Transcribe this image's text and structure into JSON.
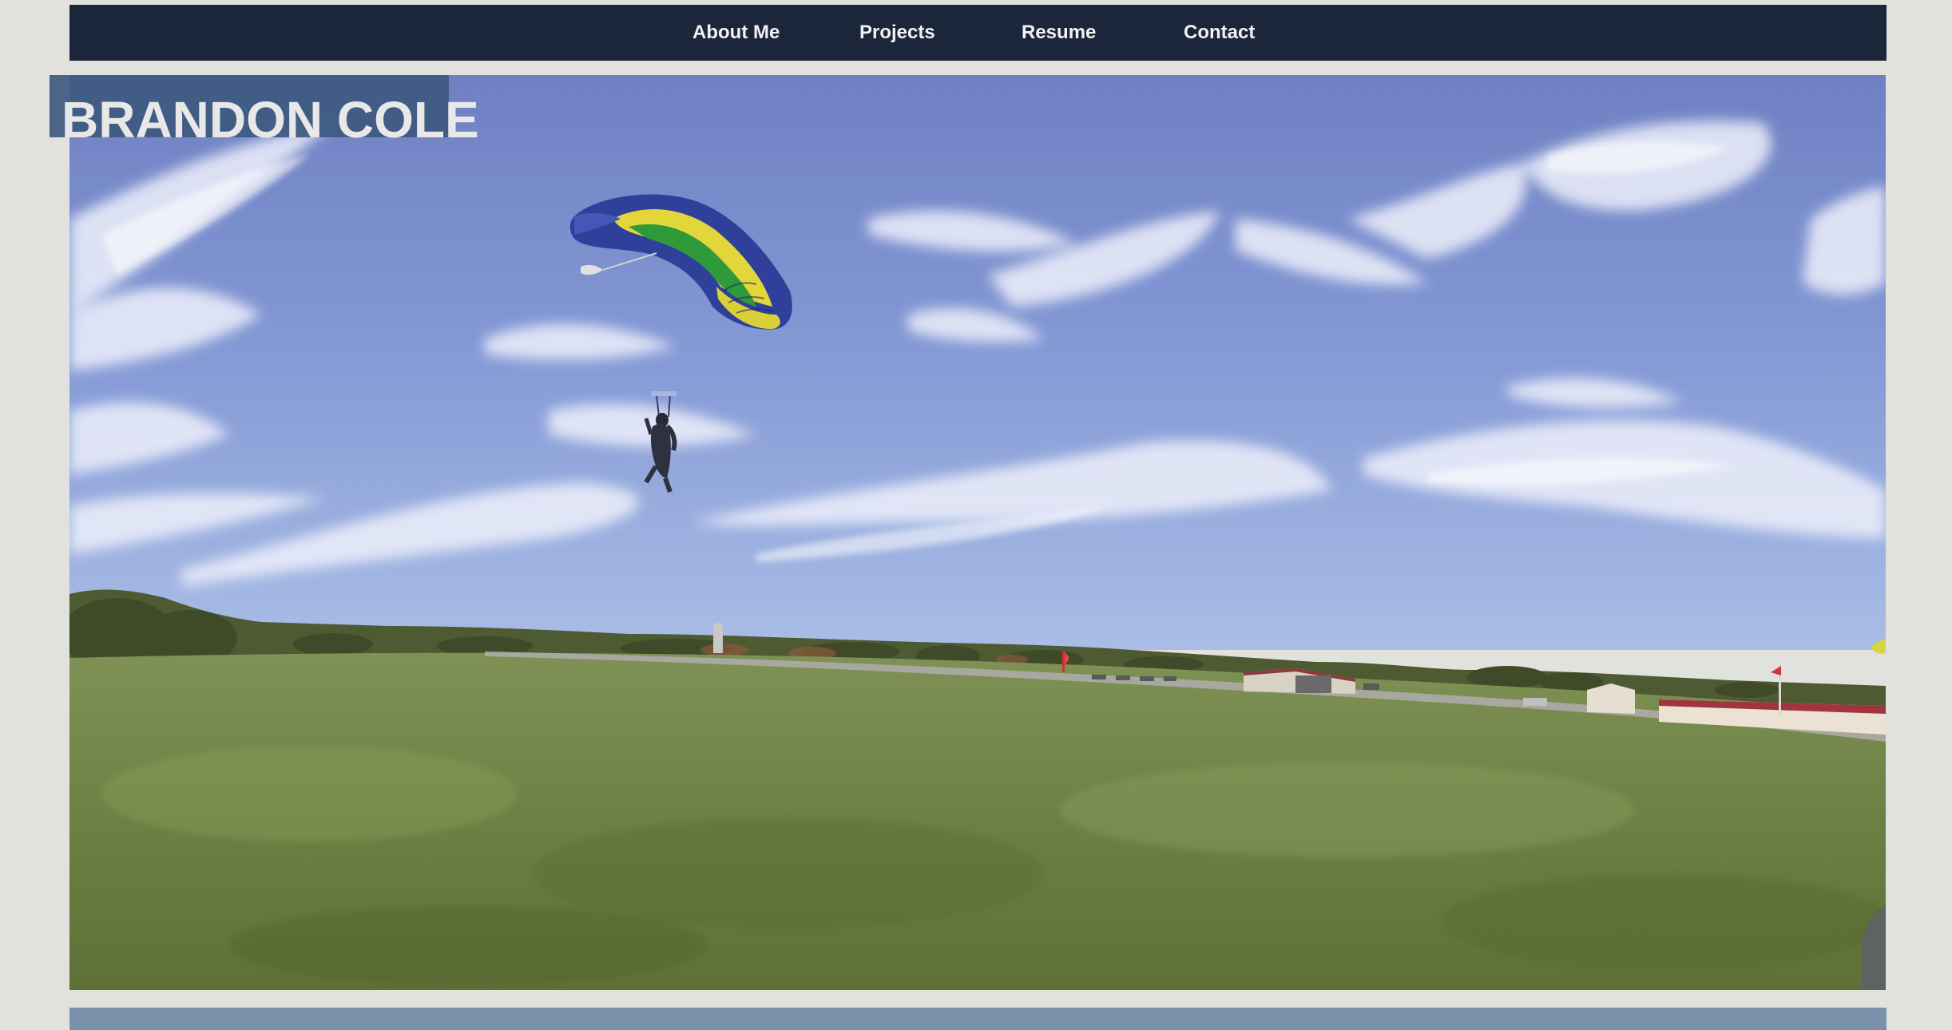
{
  "site": {
    "owner_name": "BRANDON COLE"
  },
  "nav": {
    "items": [
      {
        "label": "About Me"
      },
      {
        "label": "Projects"
      },
      {
        "label": "Resume"
      },
      {
        "label": "Contact"
      }
    ]
  },
  "colors": {
    "page_background": "#e1e2dd",
    "nav_background": "#1b263b",
    "nav_text": "#f2f2f2",
    "name_plate": "#3d5a80",
    "footer_bar": "#7a91ab"
  },
  "hero": {
    "icons": [
      "parachute-icon",
      "skydiver-icon",
      "hangar-icon",
      "windsock-icon"
    ]
  }
}
